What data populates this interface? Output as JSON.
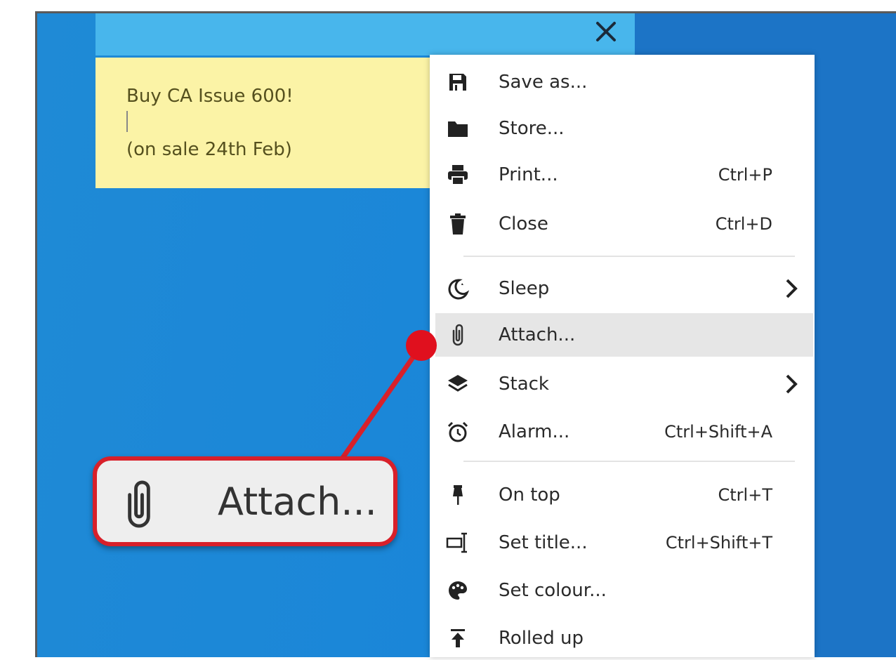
{
  "note": {
    "line1": "Buy CA Issue 600!",
    "line2": "(on sale 24th Feb)",
    "close_icon": "close-icon"
  },
  "menu": {
    "items": [
      {
        "label": "Save as...",
        "shortcut": "",
        "icon": "save-icon"
      },
      {
        "label": "Store...",
        "shortcut": "",
        "icon": "folder-icon"
      },
      {
        "label": "Print...",
        "shortcut": "Ctrl+P",
        "icon": "printer-icon"
      },
      {
        "label": "Close",
        "shortcut": "Ctrl+D",
        "icon": "trash-icon"
      },
      {
        "label": "Sleep",
        "shortcut": "",
        "icon": "moon-icon",
        "submenu": true
      },
      {
        "label": "Attach...",
        "shortcut": "",
        "icon": "paperclip-icon",
        "highlighted": true
      },
      {
        "label": "Stack",
        "shortcut": "",
        "icon": "layers-icon",
        "submenu": true
      },
      {
        "label": "Alarm...",
        "shortcut": "Ctrl+Shift+A",
        "icon": "alarm-clock-icon"
      },
      {
        "label": "On top",
        "shortcut": "Ctrl+T",
        "icon": "pin-icon"
      },
      {
        "label": "Set title...",
        "shortcut": "Ctrl+Shift+T",
        "icon": "title-icon"
      },
      {
        "label": "Set colour...",
        "shortcut": "",
        "icon": "palette-icon"
      },
      {
        "label": "Rolled up",
        "shortcut": "",
        "icon": "roll-up-icon"
      }
    ]
  },
  "callout": {
    "label": "Attach...",
    "icon": "paperclip-icon"
  },
  "colors": {
    "desktop": "#1f8ad6",
    "note_titlebar": "#48b6ec",
    "note_body": "#fbf3a6",
    "highlight": "#e6e6e6",
    "callout_border": "#d8202a"
  }
}
